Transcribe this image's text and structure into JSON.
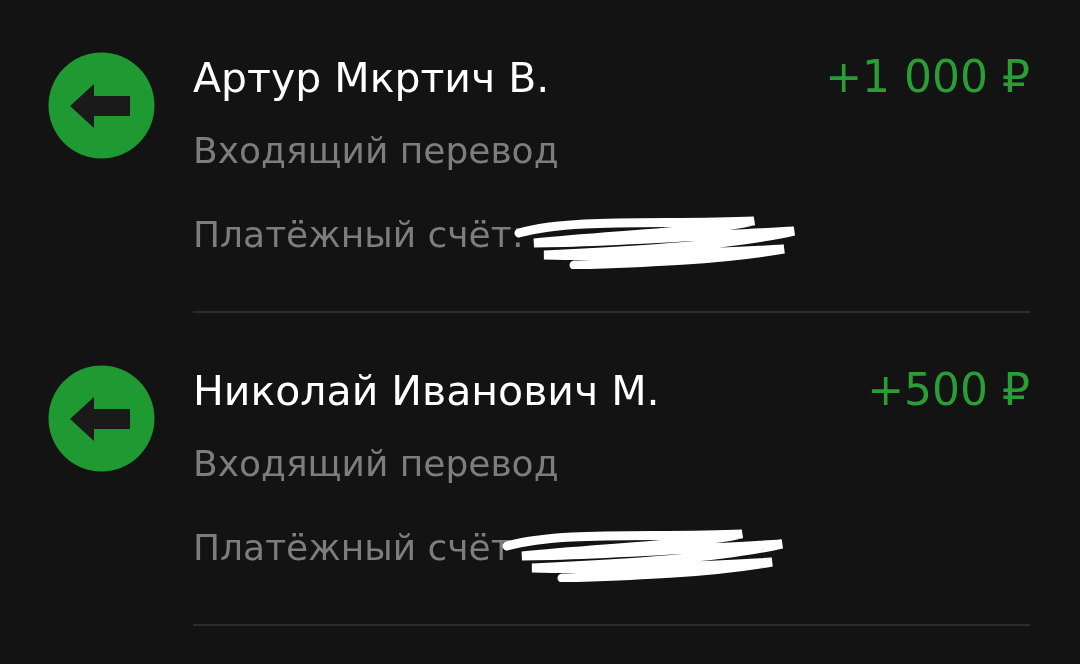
{
  "transactions": [
    {
      "kind": "incoming",
      "name": "Артур Мкртич В.",
      "amount": "+1 000 ₽",
      "subtitle": "Входящий перевод",
      "account_label": "Платёжный счёт:"
    },
    {
      "kind": "incoming",
      "name": "Николай Иванович М.",
      "amount": "+500 ₽",
      "subtitle": "Входящий перевод",
      "account_label": "Платёжный счёт"
    }
  ]
}
